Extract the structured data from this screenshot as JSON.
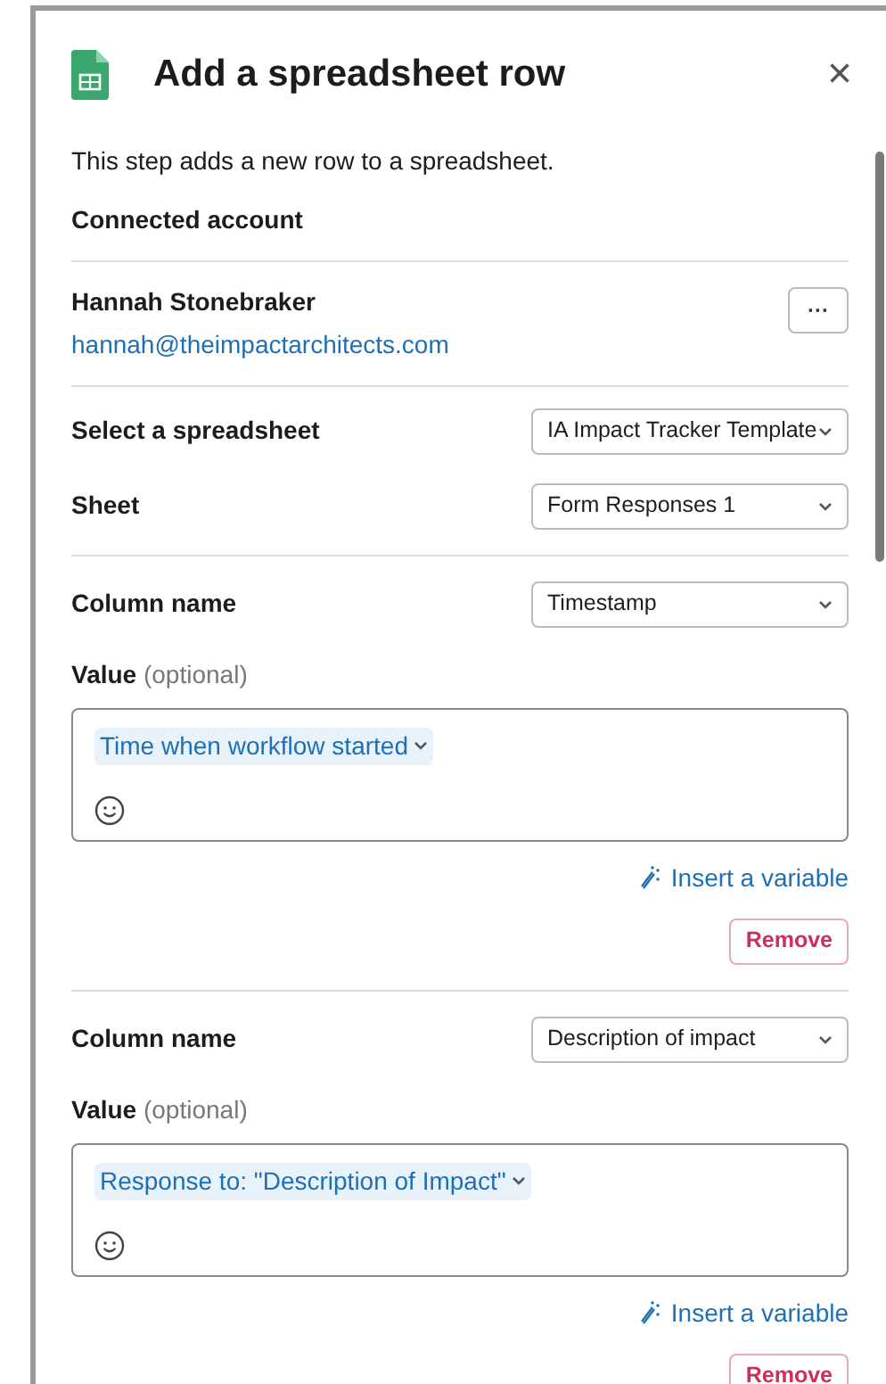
{
  "dialog": {
    "title": "Add a spreadsheet row",
    "description": "This step adds a new row to a spreadsheet.",
    "close_label": "×"
  },
  "account": {
    "heading": "Connected account",
    "name": "Hannah Stonebraker",
    "email": "hannah@theimpactarchitects.com",
    "menu_label": "···"
  },
  "spreadsheet": {
    "label": "Select a spreadsheet",
    "value": "IA Impact Tracker Template"
  },
  "sheet": {
    "label": "Sheet",
    "value": "Form Responses 1"
  },
  "columns": [
    {
      "label": "Column name",
      "value": "Timestamp",
      "value_label": "Value",
      "value_hint": "(optional)",
      "chip": "Time when workflow started",
      "insert_label": "Insert a variable",
      "remove_label": "Remove"
    },
    {
      "label": "Column name",
      "value": "Description of impact",
      "value_label": "Value",
      "value_hint": "(optional)",
      "chip": "Response to: \"Description of Impact\"",
      "insert_label": "Insert a variable",
      "remove_label": "Remove"
    }
  ]
}
